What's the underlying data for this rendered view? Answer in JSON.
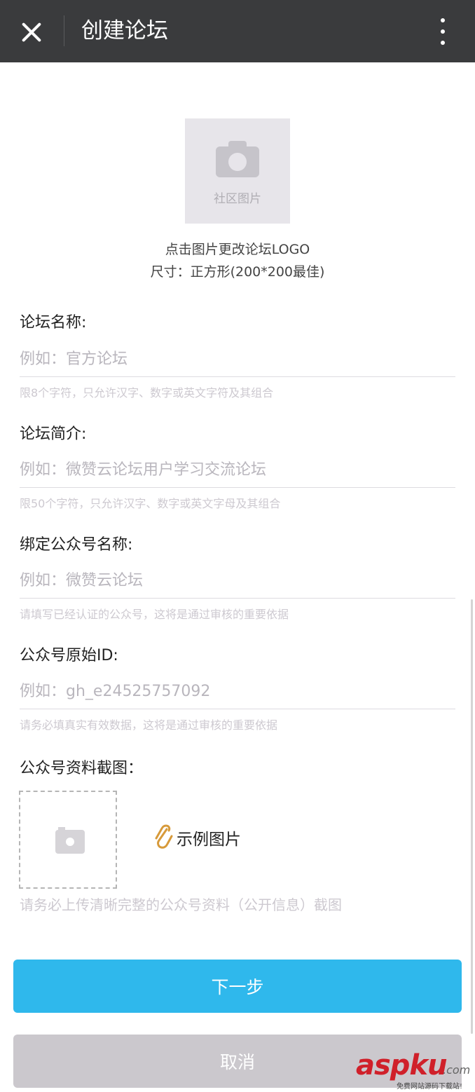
{
  "header": {
    "title": "创建论坛"
  },
  "logo": {
    "placeholder_label": "社区图片",
    "hint_line1": "点击图片更改论坛LOGO",
    "hint_line2": "尺寸：正方形(200*200最佳)"
  },
  "fields": [
    {
      "label": "论坛名称:",
      "placeholder": "例如：官方论坛",
      "hint": "限8个字符，只允许汉字、数字或英文字符及其组合"
    },
    {
      "label": "论坛简介:",
      "placeholder": "例如：微赞云论坛用户学习交流论坛",
      "hint": "限50个字符，只允许汉字、数字或英文字母及其组合"
    },
    {
      "label": "绑定公众号名称:",
      "placeholder": "例如：微赞云论坛",
      "hint": "请填写已经认证的公众号，这将是通过审核的重要依据"
    },
    {
      "label": "公众号原始ID:",
      "placeholder": "例如：gh_e24525757092",
      "hint": "请务必填真实有效数据，这将是通过审核的重要依据"
    }
  ],
  "screenshot": {
    "label": "公众号资料截图：",
    "sample_link": "示例图片",
    "hint": "请务必上传清晰完整的公众号资料（公开信息）截图"
  },
  "buttons": {
    "next": "下一步",
    "cancel": "取消"
  },
  "watermark": {
    "brand": "aspku",
    "suffix": ".com",
    "tagline": "免费网站源码下载站!"
  },
  "colors": {
    "topbar": "#3a3b3d",
    "primary": "#2fb8ec",
    "cancel": "#cbc8cd",
    "attachment": "#d79a3a",
    "watermark": "#d0202a"
  }
}
